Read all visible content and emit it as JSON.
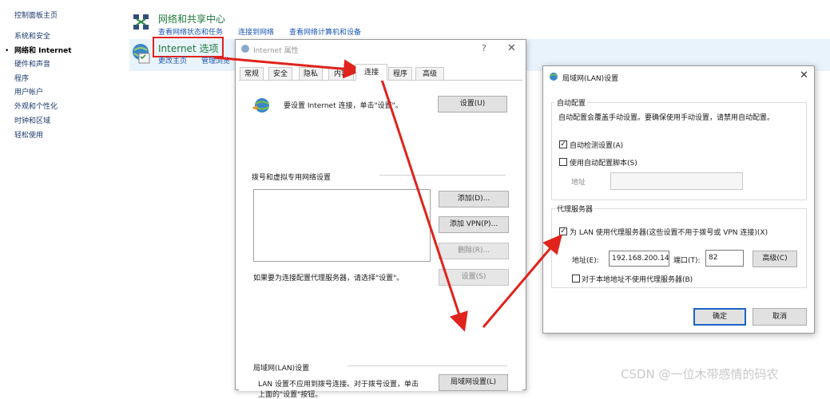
{
  "nav": {
    "home": "控制面板主页",
    "items": [
      "系统和安全",
      "网络和 Internet",
      "硬件和声音",
      "程序",
      "用户帐户",
      "外观和个性化",
      "时钟和区域",
      "轻松使用"
    ],
    "bullet": "•"
  },
  "network_center": {
    "title": "网络和共享中心",
    "links": [
      "查看网络状态和任务",
      "连接到网络",
      "查看网络计算机和设备"
    ]
  },
  "internet_options": {
    "title": "Internet 选项",
    "links": [
      "更改主页",
      "管理浏览"
    ]
  },
  "ip_dialog": {
    "title": "Internet 属性",
    "help": "?",
    "close": "✕",
    "tabs": [
      "常规",
      "安全",
      "隐私",
      "内容",
      "连接",
      "程序",
      "高级"
    ],
    "active_tab": "连接",
    "setup_text": "要设置 Internet 连接，单击\"设置\"。",
    "setup_button": "设置(U)",
    "dialup_section": "拨号和虚拟专用网络设置",
    "add_button": "添加(D)...",
    "add_vpn_button": "添加 VPN(P)...",
    "remove_button": "删除(R)...",
    "settings_button": "设置(S)",
    "proxy_hint": "如果要为连接配置代理服务器，请选择\"设置\"。",
    "lan_section": "局域网(LAN)设置",
    "lan_desc_line1": "LAN 设置不应用到拨号连接。对于拨号设置，单击",
    "lan_desc_line2": "上面的\"设置\"按钮。",
    "lan_button": "局域网设置(L)"
  },
  "lan_dialog": {
    "title": "局域网(LAN)设置",
    "close": "✕",
    "auto_config_caption": "自动配置",
    "auto_config_desc": "自动配置会覆盖手动设置。要确保使用手动设置，请禁用自动配置。",
    "auto_detect_label": "自动检测设置(A)",
    "auto_detect_checked": true,
    "auto_script_label": "使用自动配置脚本(S)",
    "auto_script_checked": false,
    "address_label": "地址",
    "address_value": "",
    "proxy_caption": "代理服务器",
    "use_proxy_label": "为 LAN 使用代理服务器(这些设置不用于拨号或 VPN 连接)(X)",
    "use_proxy_checked": true,
    "proxy_address_label": "地址(E):",
    "proxy_address_value": "192.168.200.14",
    "port_label": "端口(T):",
    "port_value": "82",
    "advanced_button": "高级(C)",
    "bypass_local_label": "对于本地地址不使用代理服务器(B)",
    "bypass_local_checked": false,
    "ok_button": "确定",
    "cancel_button": "取消",
    "check_mark": "✓"
  },
  "watermark": "CSDN @一位木带感情的码农",
  "colors": {
    "annotation_red": "#e0231c",
    "link_blue": "#1a56b4",
    "title_green": "#1e7a3d",
    "highlight": "#e9f3fb"
  },
  "icons": [
    "network-center-icon",
    "internet-options-icon",
    "globe-connection-icon",
    "ip-dialog-icon",
    "lan-dialog-icon"
  ]
}
